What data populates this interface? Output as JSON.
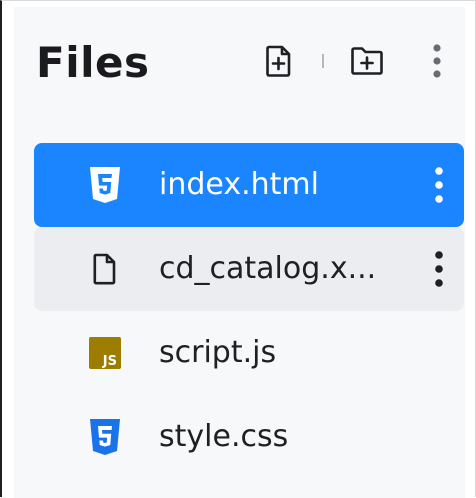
{
  "panel": {
    "title": "Files",
    "actions": {
      "new_file_icon": "file-plus-icon",
      "new_folder_icon": "folder-plus-icon",
      "more_icon": "kebab-menu-icon"
    }
  },
  "files": [
    {
      "name": "index.html",
      "icon": "html5-icon",
      "state": "selected"
    },
    {
      "name": "cd_catalog.x...",
      "icon": "file-icon",
      "state": "hovered"
    },
    {
      "name": "script.js",
      "icon": "javascript-icon",
      "state": "normal"
    },
    {
      "name": "style.css",
      "icon": "css3-icon",
      "state": "normal"
    }
  ],
  "colors": {
    "selected_bg": "#1a85ff",
    "hover_bg": "#ecedf0",
    "panel_bg": "#f7f8fa",
    "html_icon": "#ffffff",
    "css_icon": "#1a73e8",
    "js_icon_bg": "#9c7d00",
    "text": "#1f1f24"
  }
}
